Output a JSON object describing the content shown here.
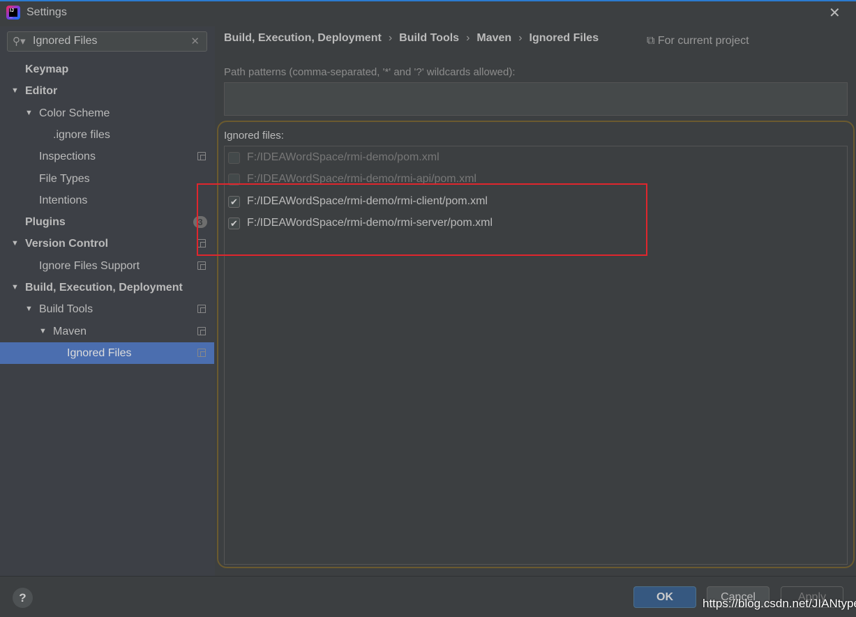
{
  "window": {
    "title": "Settings",
    "close_icon": "close-icon",
    "accent": "#4b6eaf"
  },
  "search": {
    "value": "Ignored Files"
  },
  "tree": [
    {
      "label": "Keymap",
      "level": 0,
      "bold": true,
      "arrow": false
    },
    {
      "label": "Editor",
      "level": 0,
      "bold": true,
      "arrow": true
    },
    {
      "label": "Color Scheme",
      "level": 1,
      "arrow": true
    },
    {
      "label": ".ignore files",
      "level": 2,
      "arrow": false
    },
    {
      "label": "Inspections",
      "level": 1,
      "arrow": false,
      "project_icon": true
    },
    {
      "label": "File Types",
      "level": 1,
      "arrow": false
    },
    {
      "label": "Intentions",
      "level": 1,
      "arrow": false
    },
    {
      "label": "Plugins",
      "level": 0,
      "bold": true,
      "arrow": false,
      "badge": "3"
    },
    {
      "label": "Version Control",
      "level": 0,
      "bold": true,
      "arrow": true,
      "project_icon": true
    },
    {
      "label": "Ignore Files Support",
      "level": 1,
      "arrow": false,
      "project_icon": true
    },
    {
      "label": "Build, Execution, Deployment",
      "level": 0,
      "bold": true,
      "arrow": true
    },
    {
      "label": "Build Tools",
      "level": 1,
      "arrow": true,
      "project_icon": true
    },
    {
      "label": "Maven",
      "level": 2,
      "arrow": true,
      "project_icon": true
    },
    {
      "label": "Ignored Files",
      "level": 3,
      "arrow": false,
      "project_icon": true,
      "selected": true
    }
  ],
  "breadcrumb": [
    "Build, Execution, Deployment",
    "Build Tools",
    "Maven",
    "Ignored Files"
  ],
  "scope": "For current project",
  "path_patterns": {
    "label": "Path patterns (comma-separated, '*' and '?' wildcards allowed):",
    "value": ""
  },
  "ignored": {
    "label": "Ignored files:",
    "items": [
      {
        "path": "F:/IDEAWordSpace/rmi-demo/pom.xml",
        "checked": false
      },
      {
        "path": "F:/IDEAWordSpace/rmi-demo/rmi-api/pom.xml",
        "checked": false
      },
      {
        "path": "F:/IDEAWordSpace/rmi-demo/rmi-client/pom.xml",
        "checked": true
      },
      {
        "path": "F:/IDEAWordSpace/rmi-demo/rmi-server/pom.xml",
        "checked": true
      }
    ]
  },
  "buttons": {
    "help": "?",
    "ok": "OK",
    "cancel": "Cancel",
    "apply": "Apply"
  },
  "watermark": "https://blog.csdn.net/JIANtype"
}
